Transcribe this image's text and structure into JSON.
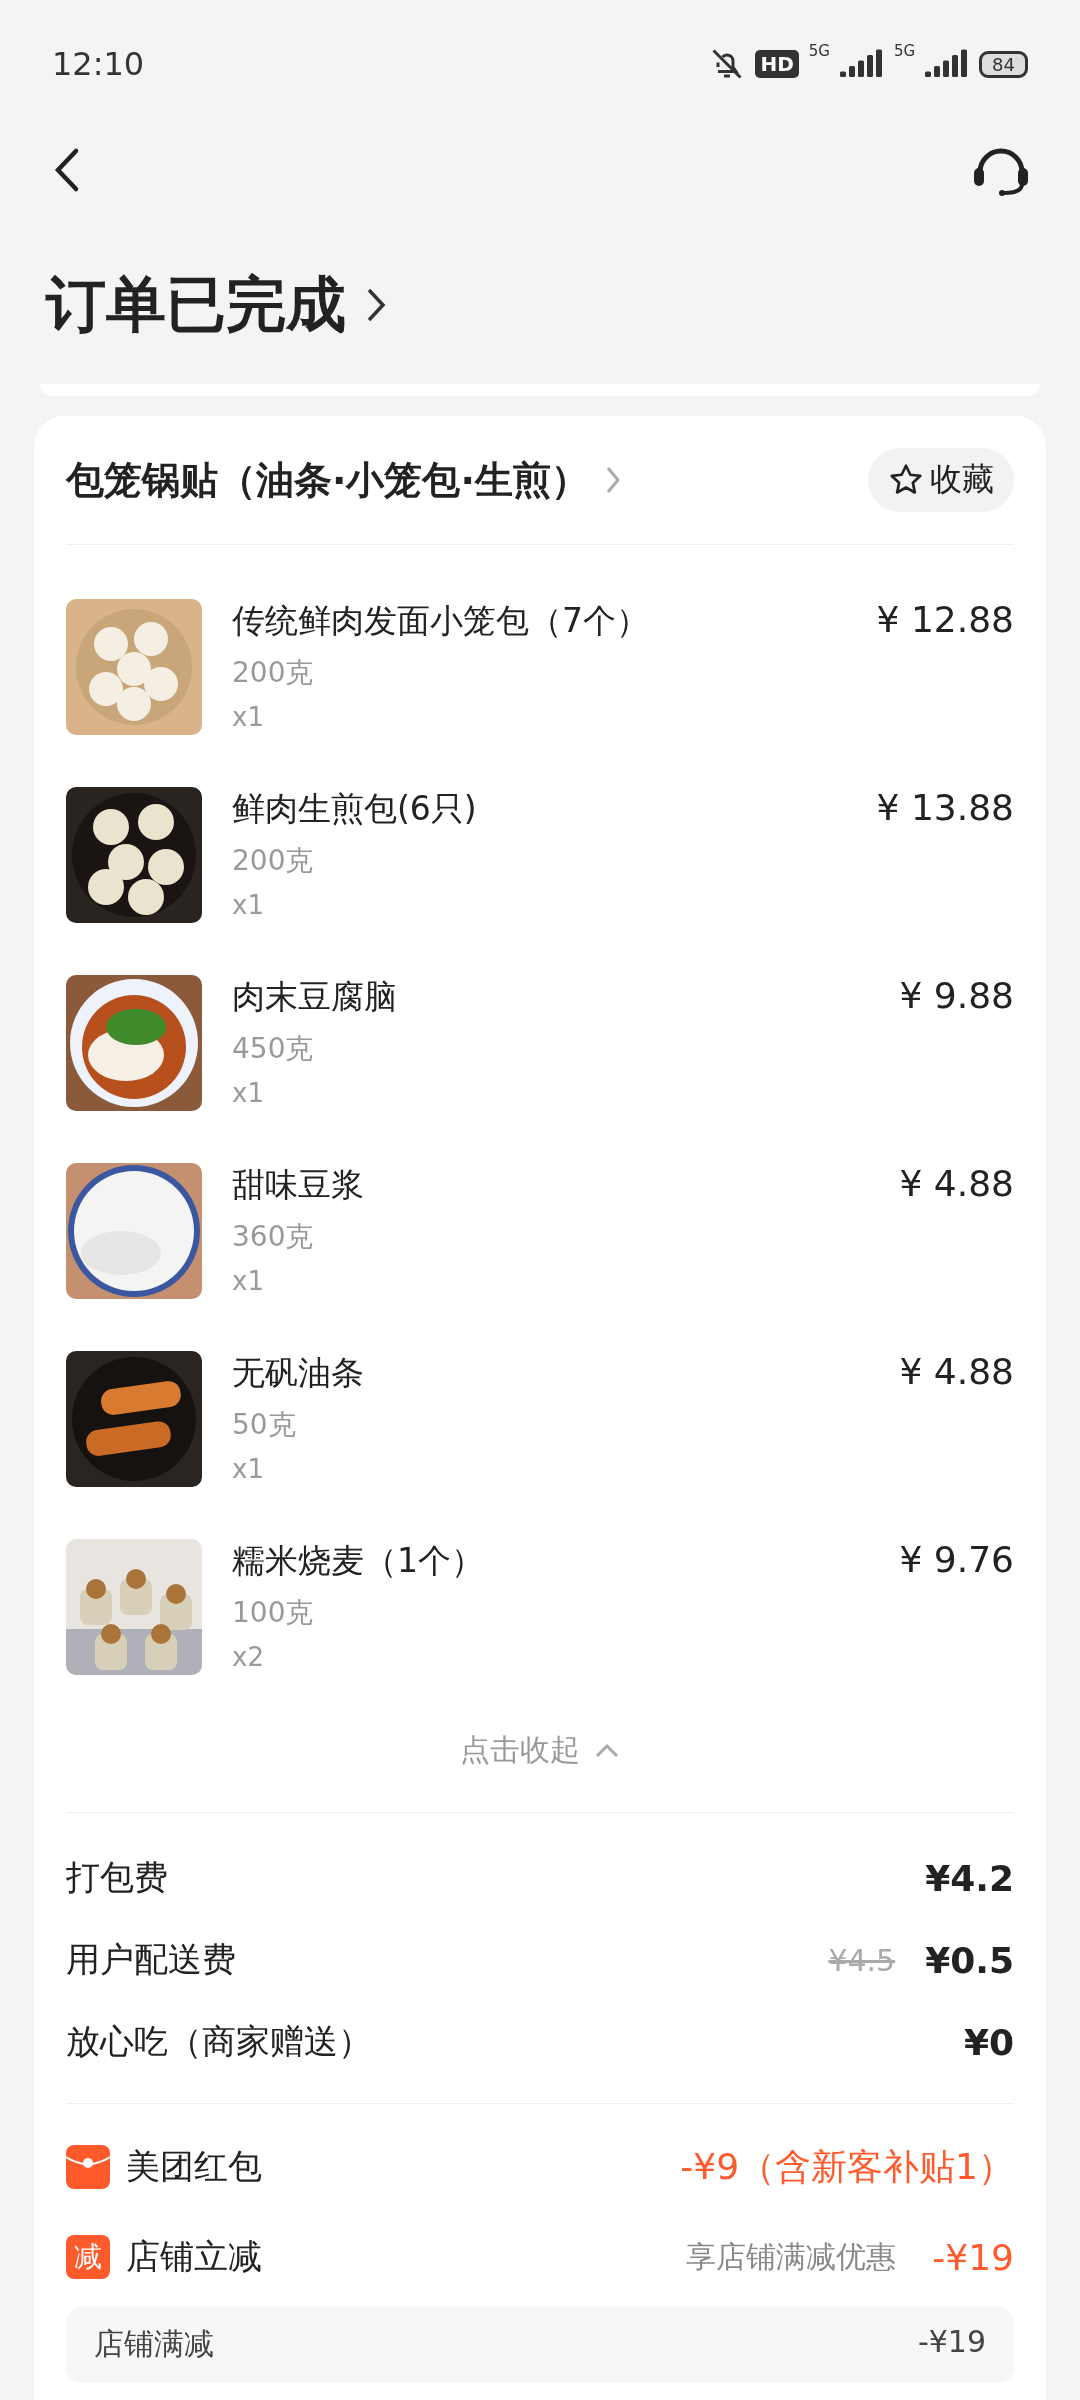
{
  "status_bar": {
    "time": "12:10",
    "hd": "HD",
    "networks": [
      "5G",
      "5G"
    ],
    "battery": "84"
  },
  "order_status": {
    "title": "订单已完成"
  },
  "store": {
    "name": "包笼锅贴（油条·小笼包·生煎）",
    "favorite_label": "收藏",
    "favorited": false
  },
  "items": [
    {
      "name": "传统鲜肉发面小笼包（7个）",
      "weight": "200克",
      "quantity": "x1",
      "price": "¥ 12.88"
    },
    {
      "name": "鲜肉生煎包(6只)",
      "weight": "200克",
      "quantity": "x1",
      "price": "¥ 13.88"
    },
    {
      "name": "肉末豆腐脑",
      "weight": "450克",
      "quantity": "x1",
      "price": "¥ 9.88"
    },
    {
      "name": "甜味豆浆",
      "weight": "360克",
      "quantity": "x1",
      "price": "¥ 4.88"
    },
    {
      "name": "无矾油条",
      "weight": "50克",
      "quantity": "x1",
      "price": "¥ 4.88"
    },
    {
      "name": "糯米烧麦（1个）",
      "weight": "100克",
      "quantity": "x2",
      "price": "¥ 9.76"
    }
  ],
  "collapse_label": "点击收起",
  "fees": [
    {
      "label": "打包费",
      "value": "¥4.2"
    },
    {
      "label": "用户配送费",
      "original_value": "¥4.5",
      "value": "¥0.5"
    },
    {
      "label": "放心吃（商家赠送）",
      "value": "¥0"
    }
  ],
  "discounts": [
    {
      "kind": "red-packet",
      "label": "美团红包",
      "value": "-¥9（含新客补贴1）"
    },
    {
      "kind": "store",
      "badge": "减",
      "label": "店铺立减",
      "note": "享店铺满减优惠",
      "value": "-¥19"
    }
  ],
  "discount_details": [
    {
      "label": "店铺满减",
      "value": "-¥19"
    }
  ]
}
